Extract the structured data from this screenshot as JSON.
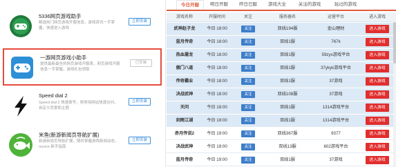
{
  "extensions": [
    {
      "name": "5336网页游戏助手",
      "desc": "精选热门网页游戏开服信息，游戏资讯一手掌握，快速进入游戏",
      "button": "立即安装",
      "icon": "gamepad-icon",
      "added": false
    },
    {
      "name": "一游网页游戏小助手",
      "desc": "提供最新最全的网页游戏开服表，网页游戏开服信息一手掌握，游戏礼包领取",
      "button": "已安装",
      "icon": "controller-icon",
      "added": true
    },
    {
      "name": "Speed dial 2",
      "desc": "Speed dial 2 快速拨号，将常用网站快速访问，自定义背景和主题",
      "button": "立即安装",
      "icon": "lightning-icon",
      "added": false
    },
    {
      "name": "米鱼(新游新闻页导航扩展)",
      "desc": "新游新闻页导航扩展，随时掌握游戏新闻动态，novice 新手指南",
      "button": "立即安装",
      "icon": "fish-icon",
      "added": false
    }
  ],
  "tabs": [
    "今日开服",
    "明日开服",
    "昨日已服",
    "游戏大全",
    "关注的游戏",
    "玩过的游戏"
  ],
  "columns": [
    "游戏名称",
    "开服时间",
    "关注",
    "服务器名",
    "运营平台",
    "进入游戏"
  ],
  "rows": [
    {
      "game": "武神赵子龙",
      "time": "今日 18:00",
      "follow": "关注",
      "server": "双线194服",
      "platform": "金山理财",
      "enter": "进入游戏",
      "hl": true
    },
    {
      "game": "蓝月传奇",
      "time": "今日 18:00",
      "follow": "关注",
      "server": "双线1服",
      "platform": "767k",
      "enter": "进入游戏",
      "hl": true
    },
    {
      "game": "热血屠龙",
      "time": "今日 18:00",
      "follow": "关注",
      "server": "双线1服",
      "platform": "59zyx游戏平台",
      "enter": "进入游戏",
      "hl": true
    },
    {
      "game": "傲门八道",
      "time": "今日 18:00",
      "follow": "关注",
      "server": "双线1服",
      "platform": "37ykyk游戏平台",
      "enter": "进入游戏",
      "hl": true
    },
    {
      "game": "传奇霸业",
      "time": "今日 18:00",
      "follow": "关注",
      "server": "双线1服",
      "platform": "37游戏",
      "enter": "进入游戏",
      "hl": true
    },
    {
      "game": "决战武神",
      "time": "今日 18:00",
      "follow": "关注",
      "server": "双线108服",
      "platform": "37游戏",
      "enter": "进入游戏",
      "hl": true
    },
    {
      "game": "天问",
      "time": "今日 18:00",
      "follow": "关注",
      "server": "双线1服",
      "platform": "1314游戏平台",
      "enter": "进入游戏",
      "hl": true
    },
    {
      "game": "剑雨江湖",
      "time": "今日 18:00",
      "follow": "关注",
      "server": "双线1服",
      "platform": "1314游戏平台",
      "enter": "进入游戏",
      "hl": true
    },
    {
      "game": "赤月传说2",
      "time": "今日 19:00",
      "follow": "关注",
      "server": "双线367服",
      "platform": "9377",
      "enter": "进入游戏",
      "hl": false
    },
    {
      "game": "决战武神",
      "time": "今日 19:00",
      "follow": "关注",
      "server": "双线13服",
      "platform": "602游戏平台",
      "enter": "进入游戏",
      "hl": false
    },
    {
      "game": "蓝月传奇",
      "time": "今日 19:00",
      "follow": "关注",
      "server": "双线1服",
      "platform": "37游戏",
      "enter": "进入游戏",
      "hl": false
    }
  ]
}
